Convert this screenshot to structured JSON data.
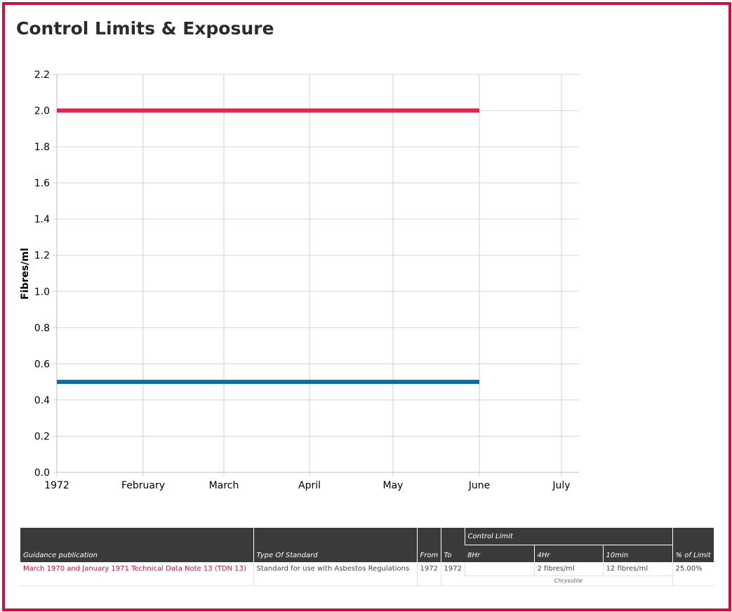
{
  "title": "Control Limits & Exposure",
  "colors": {
    "frame": "#d0103a",
    "header_bg": "#3a3a3a",
    "link": "#d0103a"
  },
  "chart_data": {
    "type": "line",
    "ylabel": "Fibres/ml",
    "xlabel": "",
    "ylim": [
      0,
      2.2
    ],
    "yticks": [
      "0.0",
      "0.2",
      "0.4",
      "0.6",
      "0.8",
      "1.0",
      "1.2",
      "1.4",
      "1.6",
      "1.8",
      "2.0",
      "2.2"
    ],
    "xticks": [
      "1972",
      "February",
      "March",
      "April",
      "May",
      "June",
      "July"
    ],
    "grid": true,
    "series": [
      {
        "color": "#e0264a",
        "x": [
          "1972-01-01",
          "1972-06-01"
        ],
        "y": [
          2.0,
          2.0
        ]
      },
      {
        "color": "#0c6e9a",
        "x": [
          "1972-01-01",
          "1972-06-01"
        ],
        "y": [
          0.5,
          0.5
        ]
      }
    ]
  },
  "table": {
    "headers": {
      "publication": "Guidance publication",
      "type": "Type Of Standard",
      "from": "From",
      "to": "To",
      "control_limit": "Control Limit",
      "h8": "8Hr",
      "h4": "4Hr",
      "m10": "10min",
      "pct": "% of Limit"
    },
    "rows": [
      {
        "publication": "March 1970 and January 1971 Technical Data Note 13 (TDN 13)",
        "type": "Standard for use with Asbestos Regulations",
        "from": "1972",
        "to": "1972",
        "h8": "",
        "h4": "2 fibres/ml",
        "m10": "12 fibres/ml",
        "pct": "25.00%",
        "substance": "Chrysotile"
      }
    ]
  }
}
